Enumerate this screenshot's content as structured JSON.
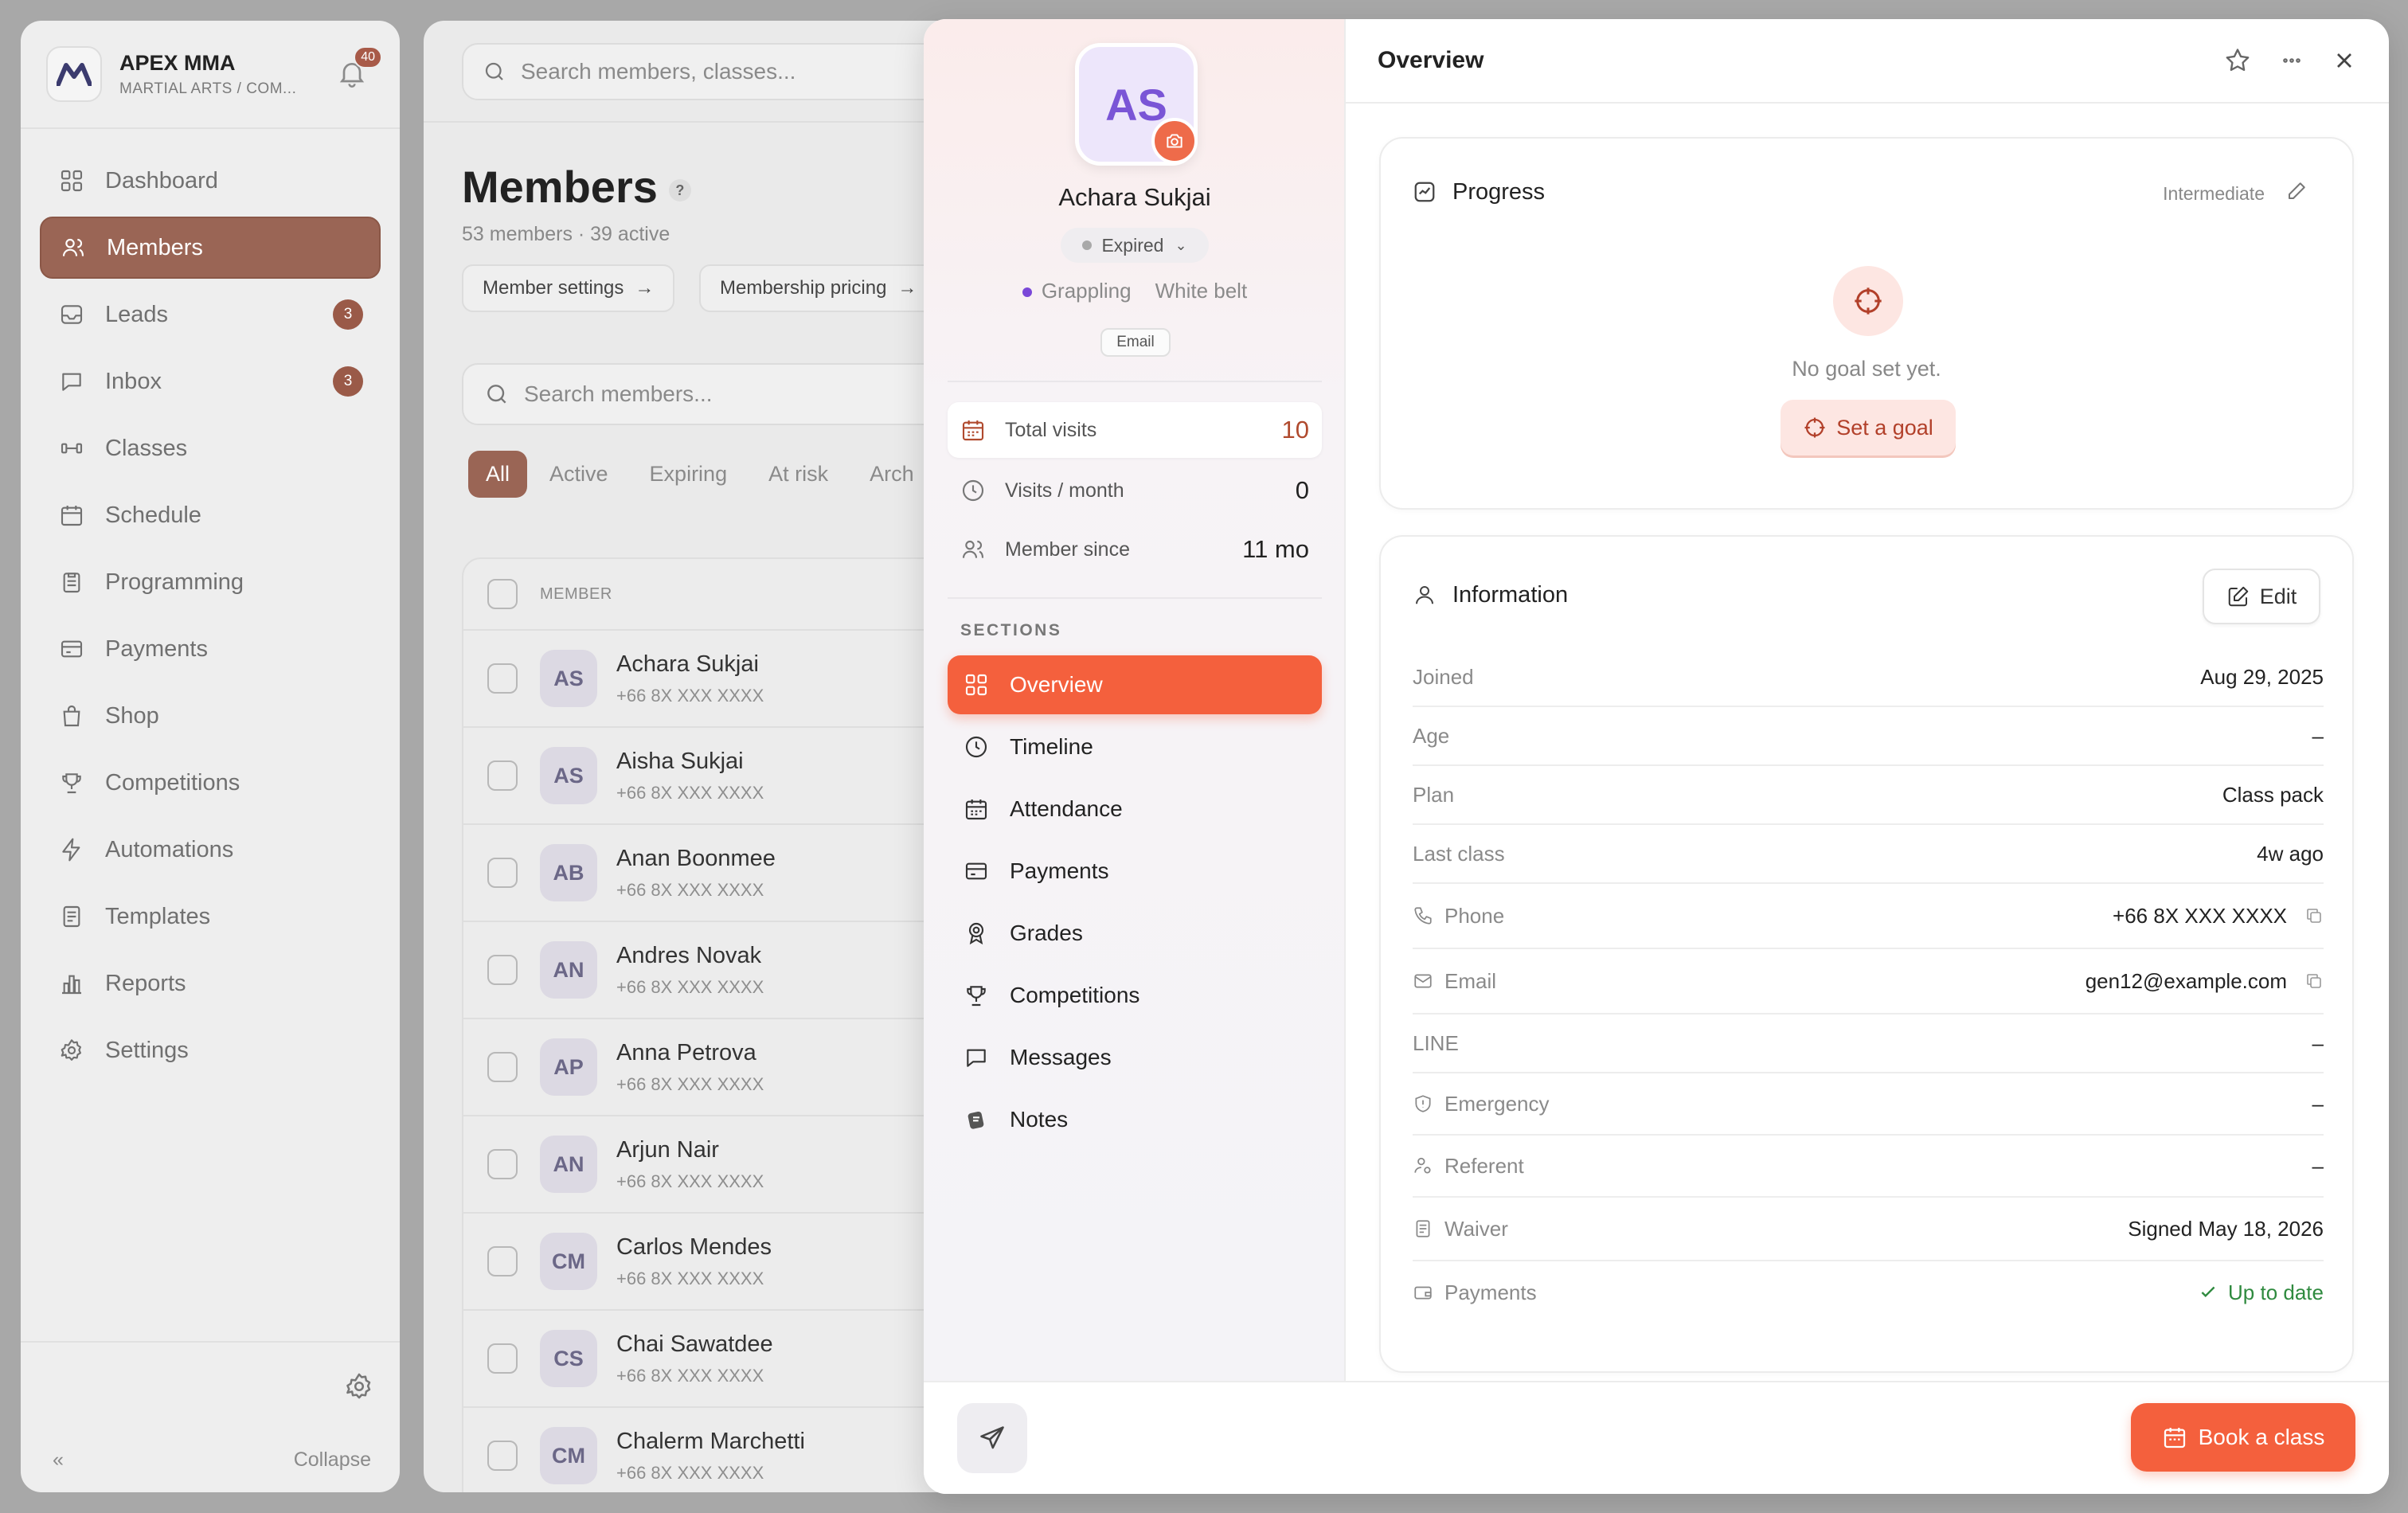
{
  "org": {
    "name": "APEX MMA",
    "subtitle": "MARTIAL ARTS / COM...",
    "notifications": "40"
  },
  "sidebar": {
    "items": [
      {
        "label": "Dashboard",
        "icon": "grid-icon"
      },
      {
        "label": "Members",
        "icon": "users-icon"
      },
      {
        "label": "Leads",
        "icon": "inbox-tray-icon",
        "badge": "3"
      },
      {
        "label": "Inbox",
        "icon": "chat-bubble-icon",
        "badge": "3"
      },
      {
        "label": "Classes",
        "icon": "dumbbell-icon"
      },
      {
        "label": "Schedule",
        "icon": "calendar-icon"
      },
      {
        "label": "Programming",
        "icon": "clipboard-icon"
      },
      {
        "label": "Payments",
        "icon": "credit-card-icon"
      },
      {
        "label": "Shop",
        "icon": "shopping-bag-icon"
      },
      {
        "label": "Competitions",
        "icon": "trophy-icon"
      },
      {
        "label": "Automations",
        "icon": "bolt-icon"
      },
      {
        "label": "Templates",
        "icon": "document-icon"
      },
      {
        "label": "Reports",
        "icon": "bar-chart-icon"
      },
      {
        "label": "Settings",
        "icon": "gear-icon"
      }
    ],
    "collapse_label": "Collapse"
  },
  "main": {
    "search_placeholder": "Search members, classes...",
    "title": "Members",
    "help": "?",
    "subtitle": "53 members · 39 active",
    "pills": [
      "Member settings",
      "Membership pricing"
    ],
    "list_search_placeholder": "Search members...",
    "tabs": [
      "All",
      "Active",
      "Expiring",
      "At risk",
      "Arch"
    ],
    "column_member": "MEMBER",
    "rows": [
      {
        "initials": "AS",
        "name": "Achara Sukjai",
        "phone": "+66 8X XXX XXXX"
      },
      {
        "initials": "AS",
        "name": "Aisha Sukjai",
        "phone": "+66 8X XXX XXXX"
      },
      {
        "initials": "AB",
        "name": "Anan Boonmee",
        "phone": "+66 8X XXX XXXX"
      },
      {
        "initials": "AN",
        "name": "Andres Novak",
        "phone": "+66 8X XXX XXXX"
      },
      {
        "initials": "AP",
        "name": "Anna Petrova",
        "phone": "+66 8X XXX XXXX"
      },
      {
        "initials": "AN",
        "name": "Arjun Nair",
        "phone": "+66 8X XXX XXXX"
      },
      {
        "initials": "CM",
        "name": "Carlos Mendes",
        "phone": "+66 8X XXX XXXX"
      },
      {
        "initials": "CS",
        "name": "Chai Sawatdee",
        "phone": "+66 8X XXX XXXX"
      },
      {
        "initials": "CM",
        "name": "Chalerm Marchetti",
        "phone": "+66 8X XXX XXXX"
      }
    ]
  },
  "drawer": {
    "initials": "AS",
    "name": "Achara Sukjai",
    "status": "Expired",
    "discipline": "Grappling",
    "belt": "White belt",
    "contact_tag": "Email",
    "stats": [
      {
        "label": "Total visits",
        "value": "10"
      },
      {
        "label": "Visits / month",
        "value": "0"
      },
      {
        "label": "Member since",
        "value": "11 mo"
      }
    ],
    "sections_heading": "SECTIONS",
    "sections": [
      "Overview",
      "Timeline",
      "Attendance",
      "Payments",
      "Grades",
      "Competitions",
      "Messages",
      "Notes"
    ],
    "header_title": "Overview",
    "progress": {
      "title": "Progress",
      "level": "Intermediate",
      "empty_text": "No goal set yet.",
      "button": "Set a goal"
    },
    "information": {
      "title": "Information",
      "edit": "Edit",
      "rows": [
        {
          "label": "Joined",
          "value": "Aug 29, 2025"
        },
        {
          "label": "Age",
          "value": "–"
        },
        {
          "label": "Plan",
          "value": "Class pack"
        },
        {
          "label": "Last class",
          "value": "4w ago"
        },
        {
          "label": "Phone",
          "value": "+66 8X XXX XXXX"
        },
        {
          "label": "Email",
          "value": "gen12@example.com"
        },
        {
          "label": "LINE",
          "value": "–"
        },
        {
          "label": "Emergency",
          "value": "–"
        },
        {
          "label": "Referent",
          "value": "–"
        },
        {
          "label": "Waiver",
          "value": "Signed May 18, 2026"
        },
        {
          "label": "Payments",
          "value": "Up to date"
        }
      ]
    },
    "book_button": "Book a class"
  },
  "colors": {
    "accent": "#f4603d",
    "sidebar_active": "#9a6555",
    "ok": "#2f8a3f",
    "avatar_text": "#7a55d6"
  }
}
